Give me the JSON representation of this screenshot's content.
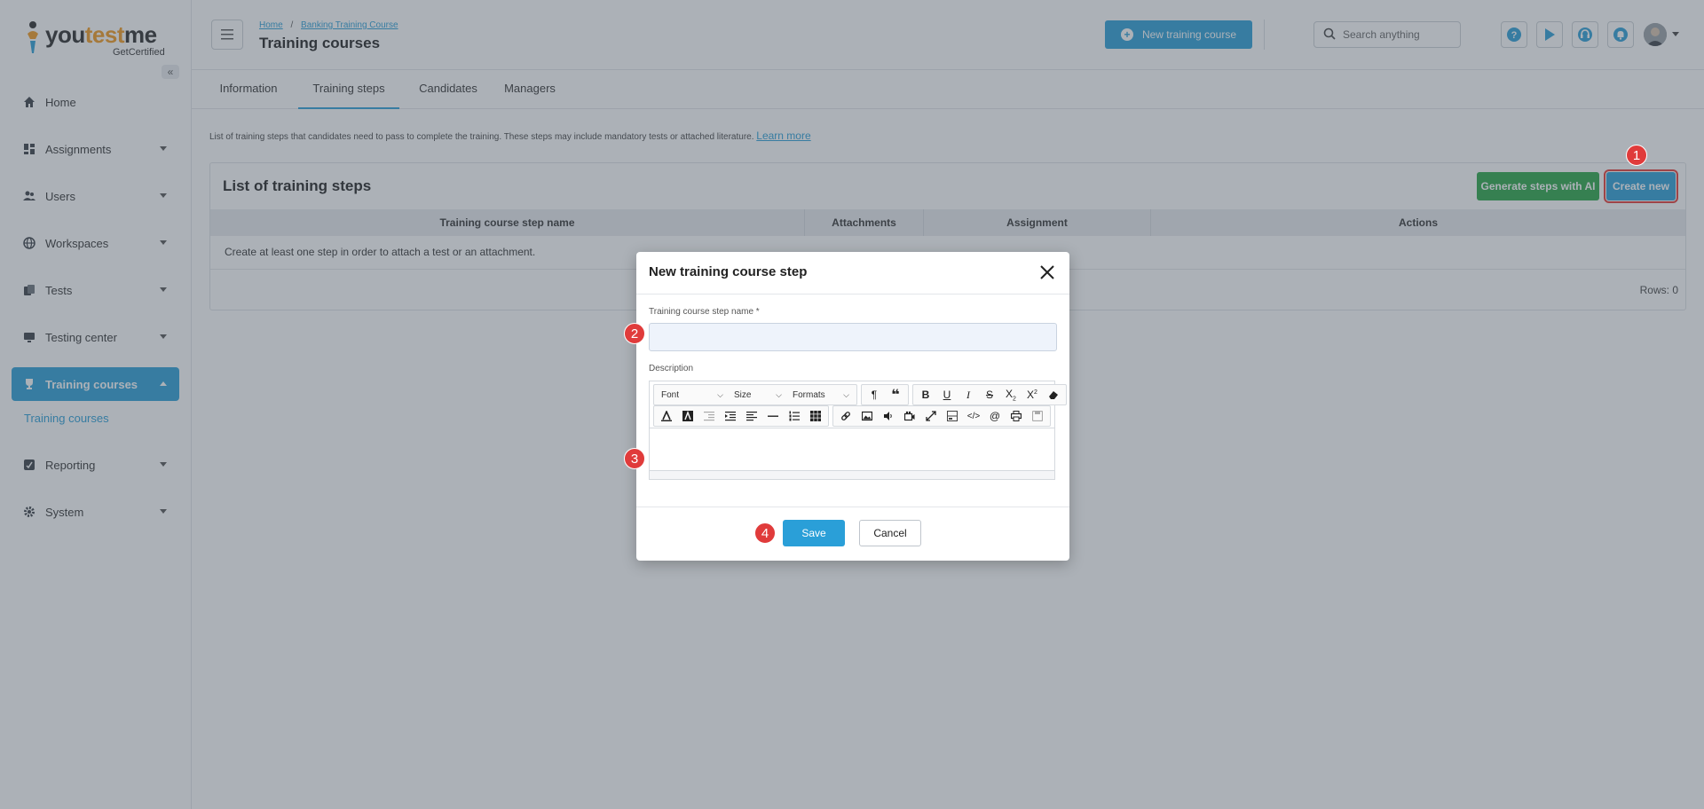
{
  "brand": {
    "name_part1": "you",
    "name_accent": "test",
    "name_part2": "me",
    "tagline": "GetCertified"
  },
  "sidebar": {
    "collapse_icon": "double-chevron-left-icon",
    "items": [
      {
        "label": "Home",
        "icon": "home-icon"
      },
      {
        "label": "Assignments",
        "icon": "dashboard-icon"
      },
      {
        "label": "Users",
        "icon": "users-icon"
      },
      {
        "label": "Workspaces",
        "icon": "globe-icon"
      },
      {
        "label": "Tests",
        "icon": "tests-icon"
      },
      {
        "label": "Testing center",
        "icon": "monitor-icon"
      },
      {
        "label": "Training courses",
        "icon": "trophy-icon"
      },
      {
        "label": "Reporting",
        "icon": "report-icon"
      },
      {
        "label": "System",
        "icon": "gear-icon"
      }
    ],
    "sub_item": "Training courses"
  },
  "header": {
    "breadcrumb_home": "Home",
    "breadcrumb_sep": "/",
    "breadcrumb_course": "Banking Training Course",
    "title": "Training courses",
    "new_course_label": "New training course",
    "search_placeholder": "Search anything",
    "help_icon": "question-icon",
    "play_icon": "play-icon",
    "support_icon": "headset-icon",
    "bell_icon": "bell-icon"
  },
  "tabs": [
    "Information",
    "Training steps",
    "Candidates",
    "Managers"
  ],
  "content": {
    "info_text": "List of training steps that candidates need to pass to complete the training. These steps may include mandatory tests or attached literature.",
    "learn_more": "Learn more",
    "panel_title": "List of training steps",
    "generate_label": "Generate steps with AI",
    "create_label": "Create new",
    "columns": [
      "Training course step name",
      "Attachments",
      "Assignment",
      "Actions"
    ],
    "empty_text": "Create at least one step in order to attach a test or an attachment.",
    "rows_count": "Rows: 0"
  },
  "modal": {
    "title": "New training course step",
    "name_label": "Training course step name *",
    "name_value": "",
    "description_label": "Description",
    "font_select": "Font",
    "size_select": "Size",
    "formats_select": "Formats",
    "save_label": "Save",
    "cancel_label": "Cancel"
  },
  "badges": [
    "1",
    "2",
    "3",
    "4"
  ],
  "colors": {
    "primary": "#2a9fd8",
    "green": "#28a745",
    "badge": "#e03b3b",
    "accent": "#f39a1e"
  }
}
